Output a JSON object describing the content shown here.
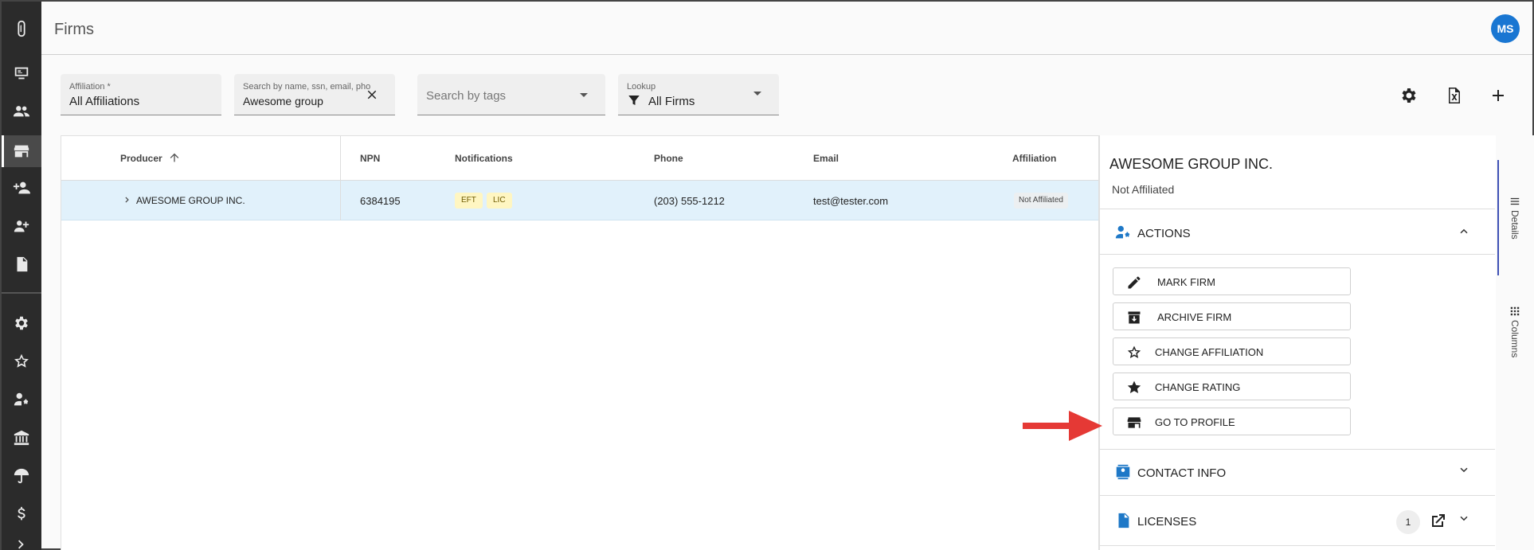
{
  "header": {
    "title": "Firms",
    "avatar_initials": "MS"
  },
  "filters": {
    "affiliation": {
      "label": "Affiliation *",
      "value": "All Affiliations"
    },
    "search": {
      "label": "Search by name, ssn, email, pho...",
      "value": "Awesome group"
    },
    "tags": {
      "placeholder": "Search by tags"
    },
    "lookup": {
      "label": "Lookup",
      "value": "All Firms"
    }
  },
  "grid": {
    "columns": [
      "Producer",
      "NPN",
      "Notifications",
      "Phone",
      "Email",
      "Affiliation"
    ],
    "rows": [
      {
        "producer": "AWESOME GROUP INC.",
        "npn": "6384195",
        "notifications": [
          "EFT",
          "LIC"
        ],
        "phone": "(203) 555-1212",
        "email": "test@tester.com",
        "affiliation": "Not Affiliated"
      }
    ]
  },
  "panel": {
    "title": "AWESOME GROUP INC.",
    "subtitle": "Not Affiliated",
    "actions_title": "ACTIONS",
    "actions": [
      "MARK FIRM",
      "ARCHIVE FIRM",
      "CHANGE AFFILIATION",
      "CHANGE RATING",
      "GO TO PROFILE"
    ],
    "contact_title": "CONTACT INFO",
    "licenses_title": "LICENSES",
    "licenses_count": "1"
  },
  "side_tabs": {
    "details": "Details",
    "columns": "Columns"
  },
  "colors": {
    "accent": "#1976d2",
    "row_selected": "#e1f1fb",
    "arrow": "#e53935"
  }
}
